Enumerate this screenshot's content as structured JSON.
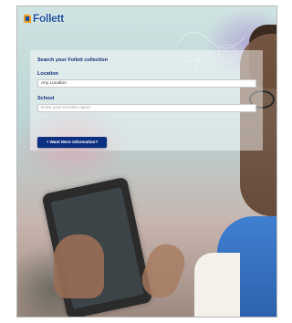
{
  "header": {
    "logo_text": "Follett"
  },
  "search": {
    "title": "Search your Follett collection",
    "location_label": "Location",
    "location_value": "Any Location",
    "school_label": "School",
    "school_placeholder": "Enter your school's name",
    "info_button_label": "+ Want More Information?"
  },
  "colors": {
    "brand_blue": "#1a4f9c",
    "heading_navy": "#12317a",
    "button_bg": "#0d2f82",
    "logo_orange": "#f39a1e"
  },
  "icons": {
    "logo_mark": "follett-logo-mark"
  }
}
